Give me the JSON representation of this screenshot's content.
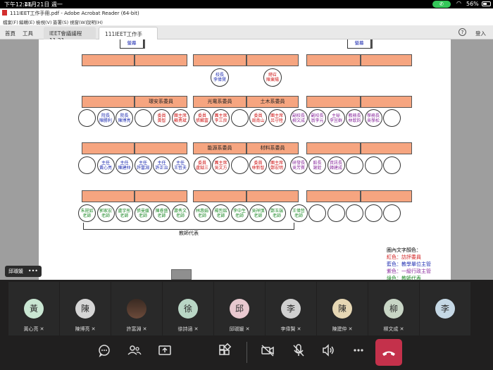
{
  "statusbar": {
    "time": "下午12:46",
    "date": "11月21日 週一",
    "battery": "56%",
    "battery_level": 0.56,
    "call_icon": "phone-icon",
    "wifi_icon": "wifi-icon"
  },
  "acrobat": {
    "window_title": "111IEET工作手冊.pdf - Adobe Acrobat Reader (64-bit)",
    "menus": [
      "檔案(F)",
      "編輯(E)",
      "檢視(V)",
      "簽署(S)",
      "視窗(W)",
      "說明(H)"
    ],
    "nav": {
      "home": "首頁",
      "tools": "工具"
    },
    "tabs": [
      "IEET會議議程11.21...",
      "111IEET工作手冊.pdf"
    ],
    "login": "登入",
    "help": "?"
  },
  "pdf": {
    "podium_left": "螢幕",
    "podium_right": "螢幕",
    "row1_top": [
      "校長\n李偉賢",
      "總召\n陳東陽"
    ],
    "depts_row1": [
      "環安系委員",
      "光電系委員",
      "土木系委員"
    ],
    "depts_row2": [
      "能源系委員",
      "材料系委員"
    ],
    "row2_circles": [
      {
        "t": "",
        "c": ""
      },
      {
        "t": "院長\n陳勝利",
        "c": "blue"
      },
      {
        "t": "院長\n陳博亮",
        "c": "blue"
      },
      {
        "t": "",
        "c": ""
      },
      {
        "t": "委員\n黃智",
        "c": "red"
      },
      {
        "t": "團主席\n蘇勇斌",
        "c": "red"
      },
      {
        "t": "委員\n張麟富",
        "c": "red"
      },
      {
        "t": "團主席\n李三良",
        "c": "red"
      },
      {
        "t": "",
        "c": ""
      },
      {
        "t": "委員\n周南山",
        "c": "red"
      },
      {
        "t": "團主席\n呂守陞",
        "c": "red"
      },
      {
        "t": "副校長\n柳文成",
        "c": "purple"
      },
      {
        "t": "副校長\n翁李元",
        "c": "purple"
      },
      {
        "t": "主秘\n李宜群",
        "c": "purple"
      },
      {
        "t": "教務長\n林歆鈞",
        "c": "purple"
      },
      {
        "t": "學務長\n吳學松",
        "c": "purple"
      },
      {
        "t": "",
        "c": ""
      }
    ],
    "row3_circles": [
      {
        "t": "",
        "c": ""
      },
      {
        "t": "主任\n黃心亮",
        "c": "blue"
      },
      {
        "t": "主任\n陳建仲",
        "c": "blue"
      },
      {
        "t": "主任\n許富淵",
        "c": "blue"
      },
      {
        "t": "主任\n許正治",
        "c": "blue"
      },
      {
        "t": "主任\n王哲夫",
        "c": "blue"
      },
      {
        "t": "委員\n盧鉞三",
        "c": "red"
      },
      {
        "t": "團主席\n吳文方",
        "c": "red"
      },
      {
        "t": "",
        "c": ""
      },
      {
        "t": "委員\n林新智",
        "c": "red"
      },
      {
        "t": "團主席\n鄭宏明",
        "c": "red"
      },
      {
        "t": "研發長\n吳芳賓",
        "c": "purple"
      },
      {
        "t": "館長\n謝銓",
        "c": "purple"
      },
      {
        "t": "資訊長\n韓建成",
        "c": "purple"
      },
      {
        "t": "",
        "c": ""
      },
      {
        "t": "",
        "c": ""
      },
      {
        "t": "",
        "c": ""
      }
    ],
    "row4_circles": [
      {
        "t": "朱崑如\n老師",
        "c": "green"
      },
      {
        "t": "郭家宏\n老師",
        "c": "green"
      },
      {
        "t": "盧宇彤\n老師",
        "c": "green"
      },
      {
        "t": "張曼媛\n老師",
        "c": "green"
      },
      {
        "t": "陳睿盛\n老師",
        "c": "green"
      },
      {
        "t": "蕭秀文\n老師",
        "c": "green"
      },
      {
        "t": "林惠娟\n老師",
        "c": "green"
      },
      {
        "t": "楊哲銘\n老師",
        "c": "green"
      },
      {
        "t": "李中生\n老師",
        "c": "green"
      },
      {
        "t": "吳祥慎\n老師",
        "c": "green"
      },
      {
        "t": "鄭玉端\n老師",
        "c": "green"
      },
      {
        "t": "王偉哲\n老師",
        "c": "green"
      },
      {
        "t": "",
        "c": ""
      },
      {
        "t": "",
        "c": ""
      },
      {
        "t": "",
        "c": ""
      },
      {
        "t": "",
        "c": ""
      },
      {
        "t": "",
        "c": ""
      }
    ],
    "bracket_label": "教師代表",
    "legend": {
      "title": "圈內文字顏色：",
      "items": [
        {
          "text": "紅色：訪評委員",
          "color": "#d01818"
        },
        {
          "text": "藍色：教學單位主管",
          "color": "#1c2bb0"
        },
        {
          "text": "紫色：一級行政主管",
          "color": "#8a2c9e"
        },
        {
          "text": "綠色：教師代表",
          "color": "#1e8a28"
        }
      ]
    }
  },
  "meeting": {
    "current_user": "邱琡媛",
    "more": "•••",
    "participants": [
      {
        "initial": "黃",
        "name": "黃心亮",
        "bg": "#c9e6d2"
      },
      {
        "initial": "陳",
        "name": "陳博亮",
        "bg": "#d5d5d5"
      },
      {
        "initial": "",
        "name": "許富淵",
        "bg": "#6b4a3a"
      },
      {
        "initial": "徐",
        "name": "徐詩涵",
        "bg": "#b9d6c5"
      },
      {
        "initial": "邱",
        "name": "邱琡媛",
        "bg": "#e8c8cf"
      },
      {
        "initial": "李",
        "name": "李偉賢",
        "bg": "#d0d0d0"
      },
      {
        "initial": "陳",
        "name": "陳建仲",
        "bg": "#e6d7b4"
      },
      {
        "initial": "柳",
        "name": "柳文成",
        "bg": "#c8d5c5"
      },
      {
        "initial": "李",
        "name": "",
        "bg": "#c5d8e5"
      }
    ],
    "toolbar": [
      "chat-icon",
      "people-icon",
      "share-icon",
      "apps-icon",
      "camera-off-icon",
      "mic-off-icon",
      "speaker-icon",
      "more-icon",
      "hangup-icon"
    ]
  }
}
